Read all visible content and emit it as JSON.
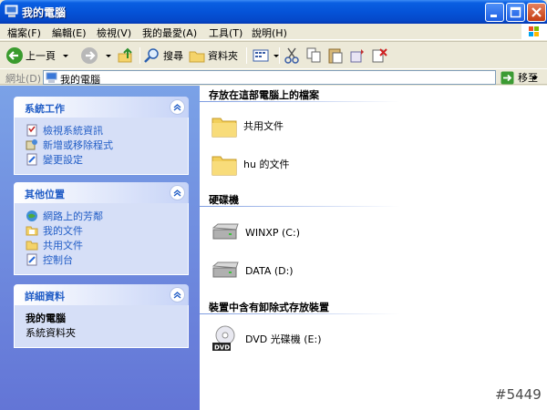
{
  "window": {
    "title": "我的電腦"
  },
  "menu": [
    "檔案(F)",
    "編輯(E)",
    "檢視(V)",
    "我的最愛(A)",
    "工具(T)",
    "說明(H)"
  ],
  "toolbar": {
    "back_label": "上一頁",
    "search_label": "搜尋",
    "folders_label": "資料夾"
  },
  "address": {
    "label": "網址(D)",
    "value": "我的電腦",
    "go_label": "移至"
  },
  "left": {
    "system_tasks": {
      "title": "系統工作",
      "items": [
        "檢視系統資訊",
        "新增或移除程式",
        "變更設定"
      ]
    },
    "other_places": {
      "title": "其他位置",
      "items": [
        "網路上的芳鄰",
        "我的文件",
        "共用文件",
        "控制台"
      ]
    },
    "details": {
      "title": "詳細資料",
      "name": "我的電腦",
      "type": "系統資料夾"
    }
  },
  "right": {
    "files_group": {
      "title": "存放在這部電腦上的檔案",
      "items": [
        "共用文件",
        "hu 的文件"
      ]
    },
    "drives_group": {
      "title": "硬碟機",
      "items": [
        "WINXP (C:)",
        "DATA (D:)"
      ]
    },
    "removable_group": {
      "title": "裝置中含有卸除式存放裝置",
      "items": [
        "DVD 光碟機 (E:)"
      ]
    }
  },
  "watermark": "#5449",
  "colors": {
    "titlebar": "#0553d8",
    "taskpane_link": "#215dc6",
    "pane_bg_top": "#7ba2e7"
  }
}
